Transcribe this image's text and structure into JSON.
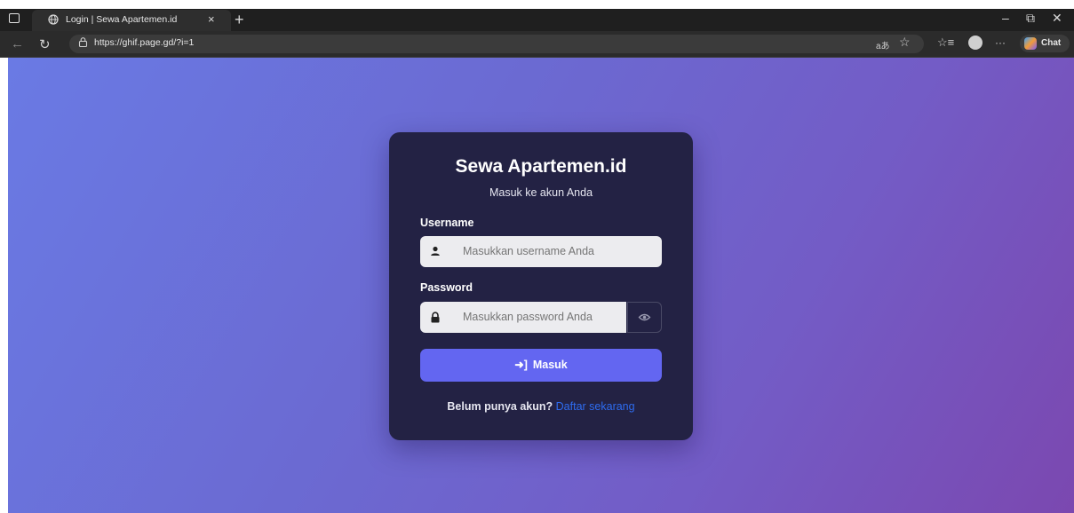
{
  "browser": {
    "tab_title": "Login | Sewa Apartemen.id",
    "tab_close": "×",
    "new_tab": "+",
    "url": "https://ghif.page.gd/?i=1",
    "read_aloud": "aあ",
    "chat_label": "Chat",
    "more": "···",
    "minimize": "–",
    "restore": "⧉",
    "close": "✕"
  },
  "login": {
    "brand": "Sewa Apartemen.id",
    "subtitle": "Masuk ke akun Anda",
    "username_label": "Username",
    "username_placeholder": "Masukkan username Anda",
    "password_label": "Password",
    "password_placeholder": "Masukkan password Anda",
    "submit_label": "Masuk",
    "footer_text": "Belum punya akun?",
    "register_link": "Daftar sekarang"
  },
  "colors": {
    "card_bg": "#232244",
    "button_bg": "#6366f1",
    "link": "#2e6cf0"
  }
}
